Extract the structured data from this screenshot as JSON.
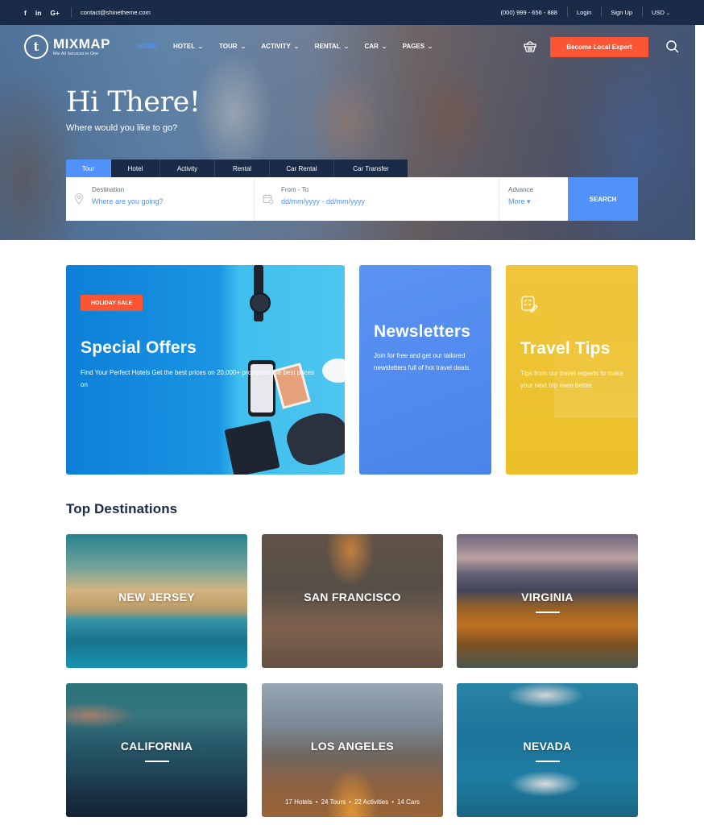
{
  "topbar": {
    "social": [
      {
        "icon": "facebook-icon",
        "glyph": "f"
      },
      {
        "icon": "linkedin-icon",
        "glyph": "in"
      },
      {
        "icon": "google-plus-icon",
        "glyph": "G+"
      }
    ],
    "email": "contact@shinetheme.com",
    "phone": "(000) 999 - 656 - 888",
    "login": "Login",
    "signup": "Sign Up",
    "currency": "USD"
  },
  "header": {
    "logo": {
      "letter": "t",
      "name": "MIXMAP",
      "tagline": "Mix All Services in One"
    },
    "nav": [
      {
        "label": "HOME",
        "active": true,
        "dropdown": false
      },
      {
        "label": "HOTEL",
        "active": false,
        "dropdown": true
      },
      {
        "label": "TOUR",
        "active": false,
        "dropdown": true
      },
      {
        "label": "ACTIVITY",
        "active": false,
        "dropdown": true
      },
      {
        "label": "RENTAL",
        "active": false,
        "dropdown": true
      },
      {
        "label": "CAR",
        "active": false,
        "dropdown": true
      },
      {
        "label": "PAGES",
        "active": false,
        "dropdown": true
      }
    ],
    "cta": "Become Local Expert"
  },
  "hero": {
    "title": "Hi There!",
    "subtitle": "Where would you like to go?",
    "tabs": [
      {
        "label": "Tour",
        "active": true
      },
      {
        "label": "Hotel",
        "active": false
      },
      {
        "label": "Activity",
        "active": false
      },
      {
        "label": "Rental",
        "active": false
      },
      {
        "label": "Car Rental",
        "active": false
      },
      {
        "label": "Car Transfer",
        "active": false
      }
    ],
    "search": {
      "destination_label": "Destination",
      "destination_placeholder": "Where are you going?",
      "dates_label": "From - To",
      "dates_placeholder": "dd/mm/yyyy - dd/mm/yyyy",
      "advance_label": "Advance",
      "advance_more": "More ▾",
      "button": "SEARCH"
    }
  },
  "promos": [
    {
      "badge": "HOLIDAY SALE",
      "title": "Special Offers",
      "text": "Find Your Perfect Hotels Get the best prices on 20,000+ properties the best prices on"
    },
    {
      "title": "Newsletters",
      "text": "Join for free and get our tailored newsletters full of hot travel deals."
    },
    {
      "title": "Travel Tips",
      "text": "Tips from our travel experts to make your next trip even better."
    }
  ],
  "destinations": {
    "title": "Top Destinations",
    "items": [
      {
        "name": "NEW JERSEY"
      },
      {
        "name": "SAN FRANCISCO"
      },
      {
        "name": "VIRGINIA"
      },
      {
        "name": "CALIFORNIA"
      },
      {
        "name": "LOS ANGELES",
        "stats": [
          "17 Hotels",
          "24 Tours",
          "22 Activities",
          "14 Cars"
        ]
      },
      {
        "name": "NEVADA"
      }
    ]
  },
  "colors": {
    "navy": "#1a2b48",
    "primary_blue": "#5191fa",
    "accent_orange": "#fa5636",
    "newsletter_blue": "#4a84ea",
    "tips_yellow": "#ebc028"
  }
}
